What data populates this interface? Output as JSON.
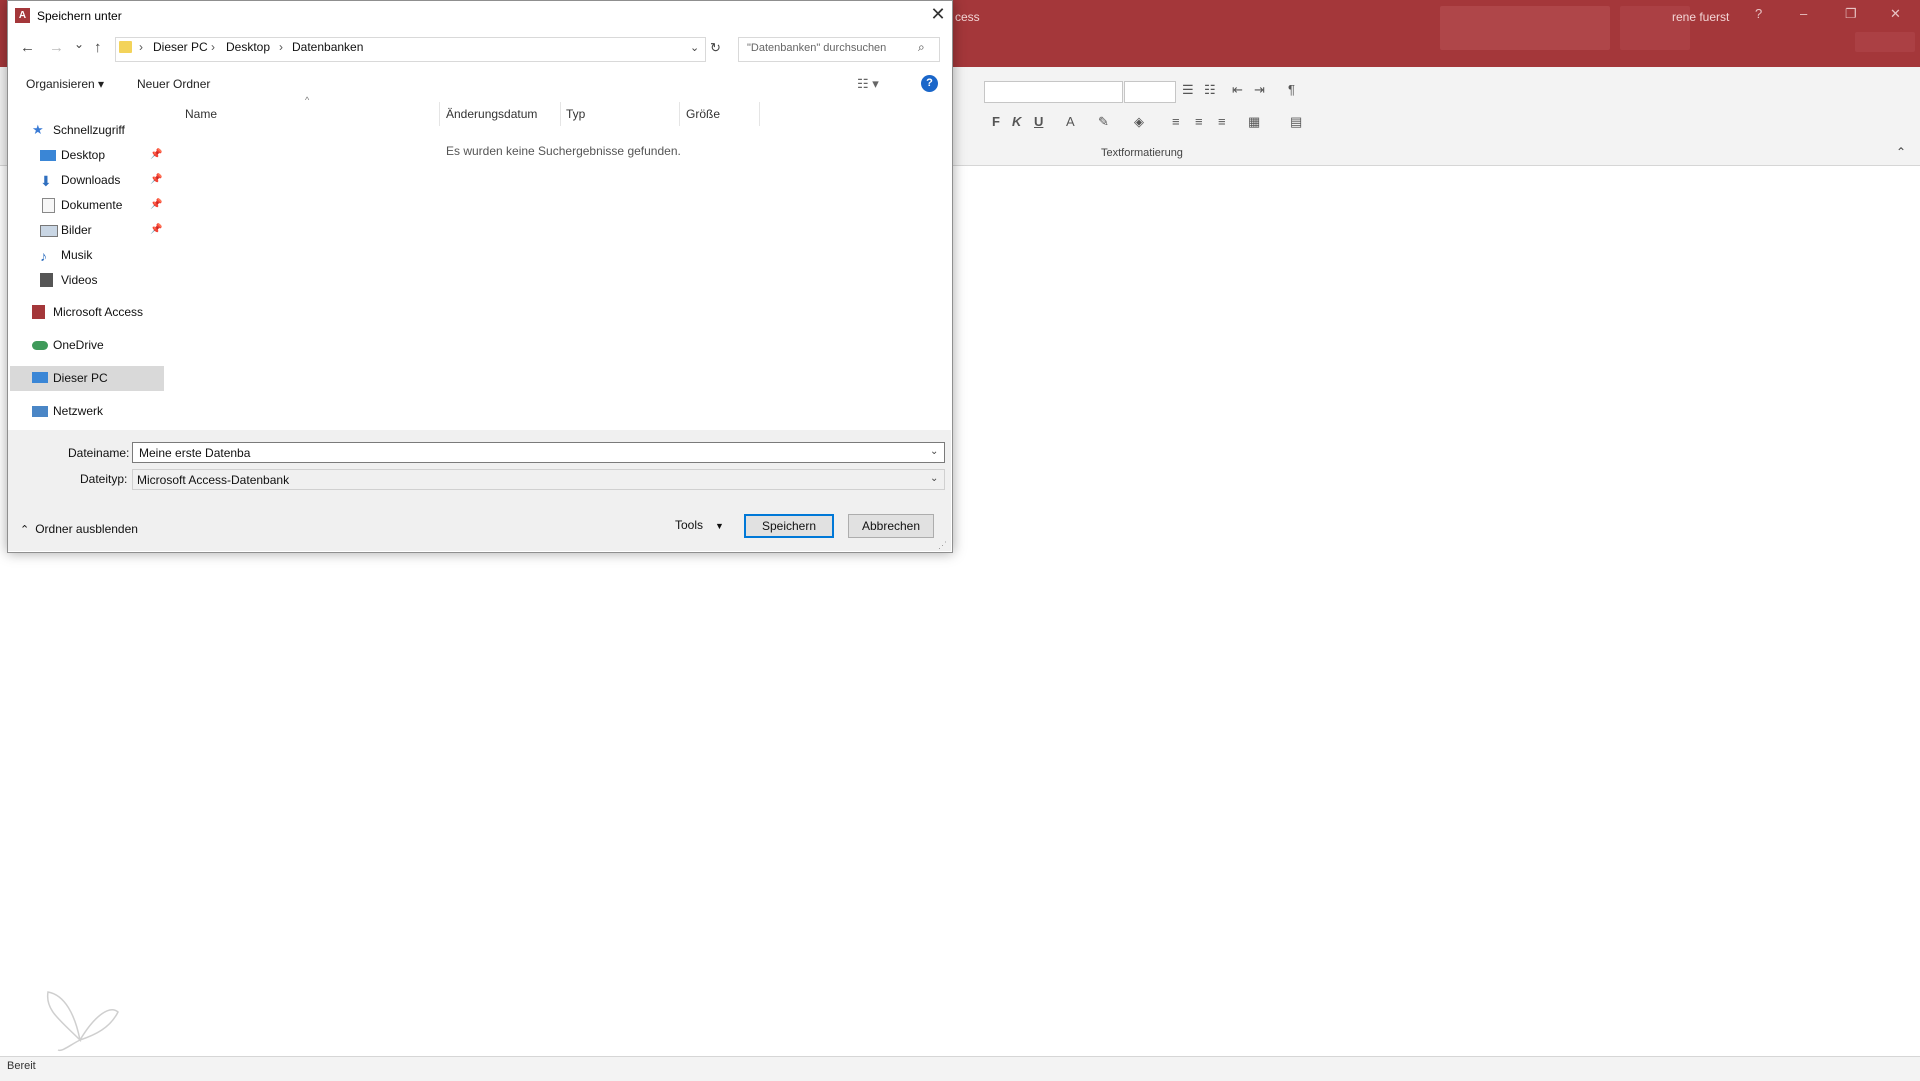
{
  "access": {
    "title_fragment": "cess",
    "user": "rene fuerst",
    "help": "?",
    "minimize": "–",
    "restore": "❐",
    "close": "✕",
    "ribbon_group_label": "Textformatierung",
    "bold": "F",
    "italic": "K",
    "underline": "U",
    "font_color": "A",
    "status": "Bereit",
    "brand_color": "#a4373a"
  },
  "dialog": {
    "title": "Speichern unter",
    "app_icon": "A",
    "close": "✕",
    "nav": {
      "back": "←",
      "forward": "→",
      "recent": "⌄",
      "up": "↑"
    },
    "breadcrumb": [
      "Dieser PC",
      "Desktop",
      "Datenbanken"
    ],
    "breadcrumb_sep": "›",
    "search_placeholder": "\"Datenbanken\" durchsuchen",
    "toolbar": {
      "organize": "Organisieren ▾",
      "new_folder": "Neuer Ordner",
      "view": "☷ ▾",
      "help": "?"
    },
    "columns": [
      "Name",
      "Änderungsdatum",
      "Typ",
      "Größe"
    ],
    "empty_message": "Es wurden keine Suchergebnisse gefunden.",
    "sidebar": {
      "quick_access": "Schnellzugriff",
      "items": [
        "Desktop",
        "Downloads",
        "Dokumente",
        "Bilder",
        "Musik",
        "Videos"
      ],
      "access": "Microsoft Access",
      "onedrive": "OneDrive",
      "this_pc": "Dieser PC",
      "network": "Netzwerk"
    },
    "filename_label": "Dateiname:",
    "filename_value": "Meine erste Datenba",
    "filetype_label": "Dateityp:",
    "filetype_value": "Microsoft Access-Datenbank",
    "hide_folders": "Ordner ausblenden",
    "tools": "Tools",
    "save": "Speichern",
    "cancel": "Abbrechen"
  }
}
